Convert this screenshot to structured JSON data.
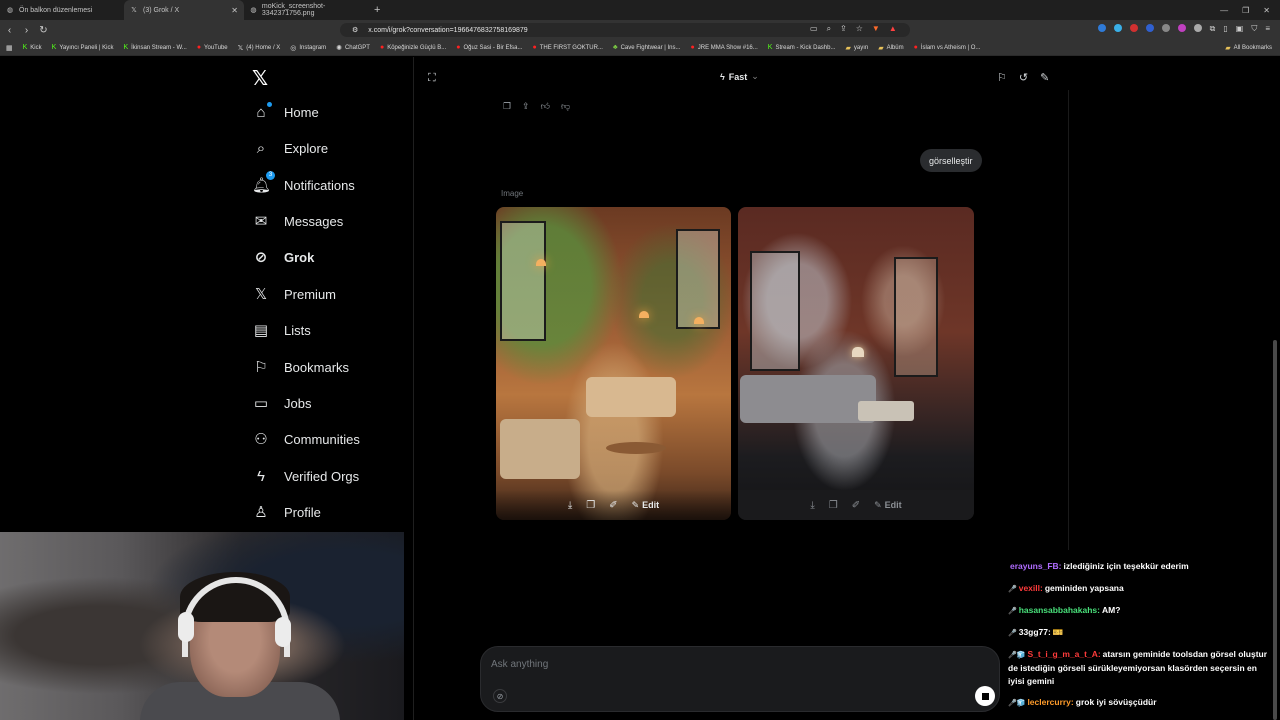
{
  "browser": {
    "tabs": [
      {
        "label": "Ön balkon düzenlemesi",
        "icon": "globe"
      },
      {
        "label": "(3) Grok / X",
        "icon": "x"
      },
      {
        "label": "moKick_screenshot-3342371756.png",
        "icon": "globe"
      }
    ],
    "url": "x.com/i/grok?conversation=1966476832758169879",
    "bookmarks": [
      "Kick",
      "Yayıncı Paneli | Kick",
      "İkinsan Stream - W...",
      "YouTube",
      "(4) Home / X",
      "Instagram",
      "ChatGPT",
      "Köpeğinizle Güçlü B...",
      "Oğuz Sasi - Bir Efsa...",
      "THE FIRST GOKTUR...",
      "Cave Fightwear | Ins...",
      "JRE MMA Show #16...",
      "Stream - Kick Dashb...",
      "yayın",
      "Albüm",
      "İslam vs Atheism | O..."
    ],
    "all_bookmarks": "All Bookmarks"
  },
  "nav": {
    "items": [
      {
        "label": "Home",
        "icon": "home-icon"
      },
      {
        "label": "Explore",
        "icon": "search-icon"
      },
      {
        "label": "Notifications",
        "icon": "bell-icon",
        "badge": "3"
      },
      {
        "label": "Messages",
        "icon": "envelope-icon"
      },
      {
        "label": "Grok",
        "icon": "grok-icon"
      },
      {
        "label": "Premium",
        "icon": "x-icon"
      },
      {
        "label": "Lists",
        "icon": "list-icon"
      },
      {
        "label": "Bookmarks",
        "icon": "bookmark-icon"
      },
      {
        "label": "Jobs",
        "icon": "briefcase-icon"
      },
      {
        "label": "Communities",
        "icon": "people-icon"
      },
      {
        "label": "Verified Orgs",
        "icon": "bolt-icon"
      },
      {
        "label": "Profile",
        "icon": "person-icon"
      }
    ]
  },
  "grok": {
    "mode": "Fast",
    "user_message": "görselleştir",
    "image_label": "Image",
    "edit_label": "Edit",
    "composer_placeholder": "Ask anything"
  },
  "chat": [
    {
      "user": "erayuns_FB:",
      "text": "izlediğiniz için teşekkür ederim",
      "color": "#b06cff",
      "icon": ""
    },
    {
      "user": "vexill:",
      "text": "geminiden yapsana",
      "color": "#ff3b3b",
      "icon": "🎤"
    },
    {
      "user": "hasansabbahakahs:",
      "text": "AM?",
      "color": "#49e07a",
      "icon": "🎤"
    },
    {
      "user": "33gg77:",
      "text": "🎫",
      "color": "#ffffff",
      "icon": "🎤"
    },
    {
      "user": "S_t_i_g_m_a_t_A:",
      "text": "atarsın geminide toolsdan görsel oluştur de istediğin görseli sürükleyemiyorsan klasörden seçersin en iyisi gemini",
      "color": "#ff3b3b",
      "icon": "🎤🧊"
    },
    {
      "user": "leclercurry:",
      "text": "grok iyi sövüşçüdür",
      "color": "#ff9c2b",
      "icon": "🎤🧊"
    }
  ]
}
